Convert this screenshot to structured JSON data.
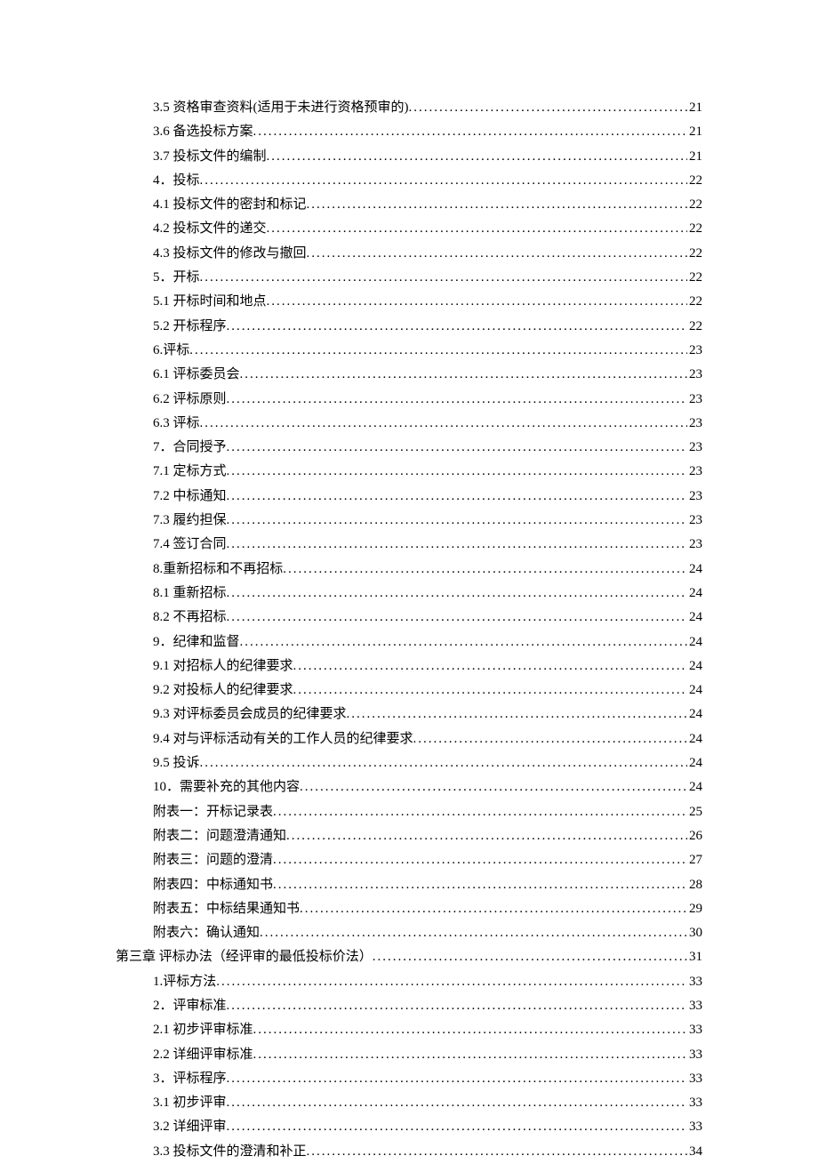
{
  "toc": [
    {
      "level": 2,
      "title": "3.5 资格审查资料(适用于未进行资格预审的)",
      "page": "21"
    },
    {
      "level": 2,
      "title": "3.6 备选投标方案",
      "page": "21"
    },
    {
      "level": 2,
      "title": "3.7 投标文件的编制",
      "page": "21"
    },
    {
      "level": 2,
      "title": "4．投标",
      "page": "22"
    },
    {
      "level": 2,
      "title": "4.1 投标文件的密封和标记",
      "page": "22"
    },
    {
      "level": 2,
      "title": "4.2 投标文件的递交",
      "page": "22"
    },
    {
      "level": 2,
      "title": "4.3 投标文件的修改与撤回",
      "page": "22"
    },
    {
      "level": 2,
      "title": "5．开标",
      "page": "22"
    },
    {
      "level": 2,
      "title": "5.1 开标时间和地点",
      "page": "22"
    },
    {
      "level": 2,
      "title": "5.2 开标程序",
      "page": "22"
    },
    {
      "level": 2,
      "title": "6.评标",
      "page": "23"
    },
    {
      "level": 2,
      "title": "6.1 评标委员会",
      "page": "23"
    },
    {
      "level": 2,
      "title": "6.2 评标原则",
      "page": "23"
    },
    {
      "level": 2,
      "title": "6.3 评标",
      "page": "23"
    },
    {
      "level": 2,
      "title": "7．合同授予",
      "page": "23"
    },
    {
      "level": 2,
      "title": "7.1 定标方式",
      "page": "23"
    },
    {
      "level": 2,
      "title": "7.2 中标通知",
      "page": "23"
    },
    {
      "level": 2,
      "title": "7.3 履约担保",
      "page": "23"
    },
    {
      "level": 2,
      "title": "7.4 签订合同",
      "page": "23"
    },
    {
      "level": 2,
      "title": "8.重新招标和不再招标",
      "page": "24"
    },
    {
      "level": 2,
      "title": "8.1 重新招标",
      "page": "24"
    },
    {
      "level": 2,
      "title": "8.2 不再招标",
      "page": "24"
    },
    {
      "level": 2,
      "title": "9．纪律和监督",
      "page": "24"
    },
    {
      "level": 2,
      "title": "9.1 对招标人的纪律要求",
      "page": "24"
    },
    {
      "level": 2,
      "title": "9.2 对投标人的纪律要求",
      "page": "24"
    },
    {
      "level": 2,
      "title": "9.3 对评标委员会成员的纪律要求",
      "page": "24"
    },
    {
      "level": 2,
      "title": "9.4 对与评标活动有关的工作人员的纪律要求",
      "page": "24"
    },
    {
      "level": 2,
      "title": "9.5 投诉",
      "page": "24"
    },
    {
      "level": 2,
      "title": "10．需要补充的其他内容",
      "page": "24"
    },
    {
      "level": 2,
      "title": "附表一：开标记录表",
      "page": "25"
    },
    {
      "level": 2,
      "title": "附表二：问题澄清通知",
      "page": "26"
    },
    {
      "level": 2,
      "title": "附表三：问题的澄清",
      "page": "27"
    },
    {
      "level": 2,
      "title": "附表四：中标通知书",
      "page": "28"
    },
    {
      "level": 2,
      "title": "附表五：中标结果通知书",
      "page": "29"
    },
    {
      "level": 2,
      "title": "附表六：确认通知",
      "page": "30"
    },
    {
      "level": 1,
      "title": "第三章 评标办法（经评审的最低投标价法）",
      "page": "31"
    },
    {
      "level": 2,
      "title": "1.评标方法",
      "page": "33"
    },
    {
      "level": 2,
      "title": "2．评审标准",
      "page": "33"
    },
    {
      "level": 2,
      "title": "2.1 初步评审标准",
      "page": "33"
    },
    {
      "level": 2,
      "title": "2.2 详细评审标准",
      "page": "33"
    },
    {
      "level": 2,
      "title": "3．评标程序",
      "page": "33"
    },
    {
      "level": 2,
      "title": "3.1 初步评审",
      "page": "33"
    },
    {
      "level": 2,
      "title": "3.2 详细评审",
      "page": "33"
    },
    {
      "level": 2,
      "title": "3.3 投标文件的澄清和补正",
      "page": "34"
    }
  ]
}
